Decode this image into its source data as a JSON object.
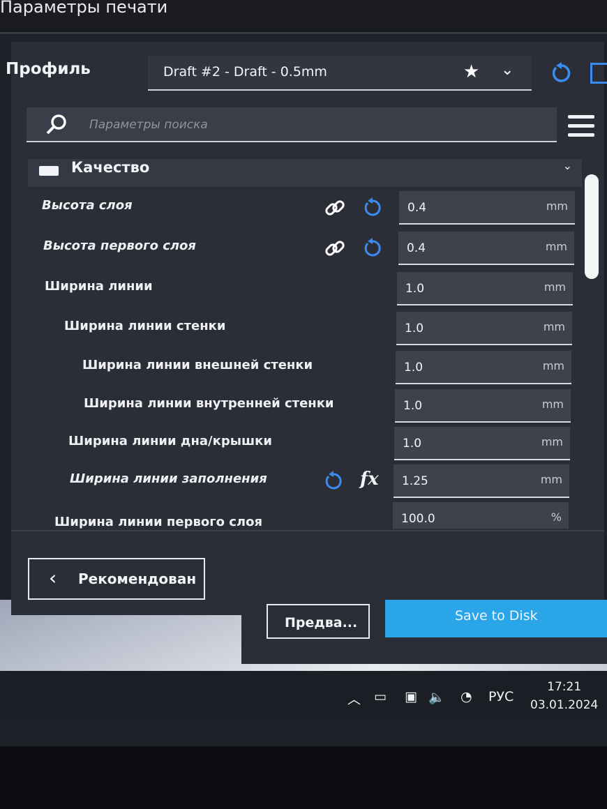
{
  "window": {
    "title": "Параметры печати"
  },
  "profile": {
    "label": "Профиль",
    "selected": "Draft #2 - Draft - 0.5mm",
    "star_icon": "star-icon",
    "reset_icon": "reset-icon",
    "save_icon": "save-icon"
  },
  "search": {
    "placeholder": "Параметры поиска"
  },
  "category": {
    "label": "Качество"
  },
  "settings": [
    {
      "label": "Высота слоя",
      "value": "0.4",
      "unit": "mm",
      "italic": true,
      "icons": [
        "link-icon",
        "reset-icon"
      ]
    },
    {
      "label": "Высота первого слоя",
      "value": "0.4",
      "unit": "mm",
      "italic": true,
      "icons": [
        "link-icon",
        "reset-icon"
      ]
    },
    {
      "label": "Ширина линии",
      "value": "1.0",
      "unit": "mm",
      "italic": false,
      "icons": []
    },
    {
      "label": "Ширина линии стенки",
      "value": "1.0",
      "unit": "mm",
      "italic": false,
      "icons": []
    },
    {
      "label": "Ширина линии внешней стенки",
      "value": "1.0",
      "unit": "mm",
      "italic": false,
      "icons": []
    },
    {
      "label": "Ширина линии внутренней стенки",
      "value": "1.0",
      "unit": "mm",
      "italic": false,
      "icons": []
    },
    {
      "label": "Ширина линии дна/крышки",
      "value": "1.0",
      "unit": "mm",
      "italic": false,
      "icons": []
    },
    {
      "label": "Ширина линии заполнения",
      "value": "1.25",
      "unit": "mm",
      "italic": true,
      "icons": [
        "reset-icon",
        "function-icon"
      ],
      "fx_label": "fx"
    },
    {
      "label": "Ширина линии первого слоя",
      "value": "100.0",
      "unit": "%",
      "italic": false,
      "icons": []
    }
  ],
  "footer": {
    "back_label": "Рекомендован"
  },
  "actions": {
    "preview_label": "Предва...",
    "save_label": "Save to Disk"
  },
  "taskbar": {
    "language": "РУС",
    "time": "17:21",
    "date": "03.01.2024"
  },
  "colors": {
    "accent": "#3a8cf0",
    "save_button": "#2aa6e8",
    "panel": "#2b2e36"
  }
}
